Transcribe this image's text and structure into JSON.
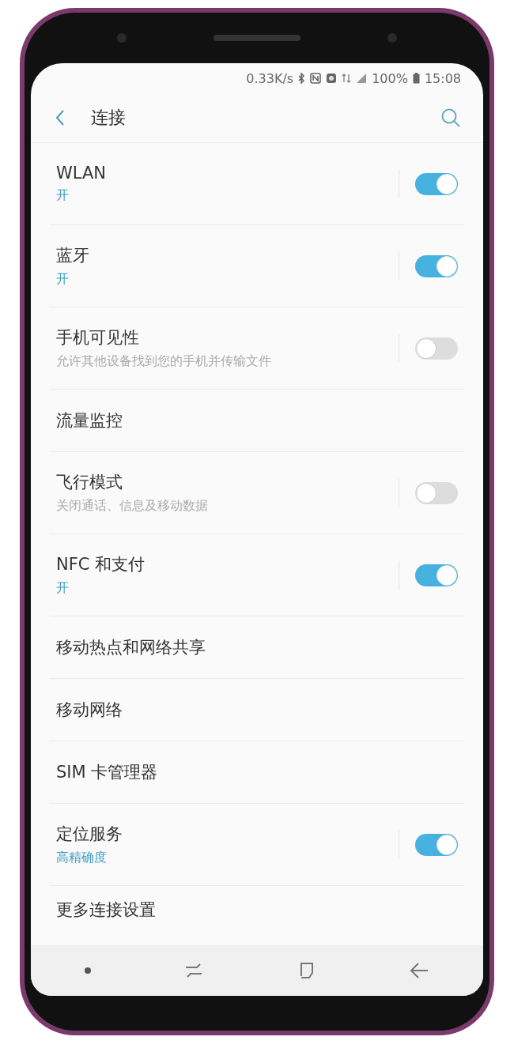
{
  "status_bar": {
    "speed": "0.33K/s",
    "battery": "100%",
    "time": "15:08"
  },
  "header": {
    "title": "连接"
  },
  "items": [
    {
      "kind": "toggle",
      "title": "WLAN",
      "status": "开",
      "on": true
    },
    {
      "kind": "toggle",
      "title": "蓝牙",
      "status": "开",
      "on": true
    },
    {
      "kind": "toggle",
      "title": "手机可见性",
      "description": "允许其他设备找到您的手机并传输文件",
      "on": false
    },
    {
      "kind": "link",
      "title": "流量监控"
    },
    {
      "kind": "toggle",
      "title": "飞行模式",
      "description": "关闭通话、信息及移动数据",
      "on": false
    },
    {
      "kind": "toggle",
      "title": "NFC 和支付",
      "status": "开",
      "on": true
    },
    {
      "kind": "link",
      "title": "移动热点和网络共享"
    },
    {
      "kind": "link",
      "title": "移动网络"
    },
    {
      "kind": "link",
      "title": "SIM 卡管理器"
    },
    {
      "kind": "toggle",
      "title": "定位服务",
      "status": "高精确度",
      "on": true
    },
    {
      "kind": "link",
      "title": "更多连接设置"
    }
  ]
}
